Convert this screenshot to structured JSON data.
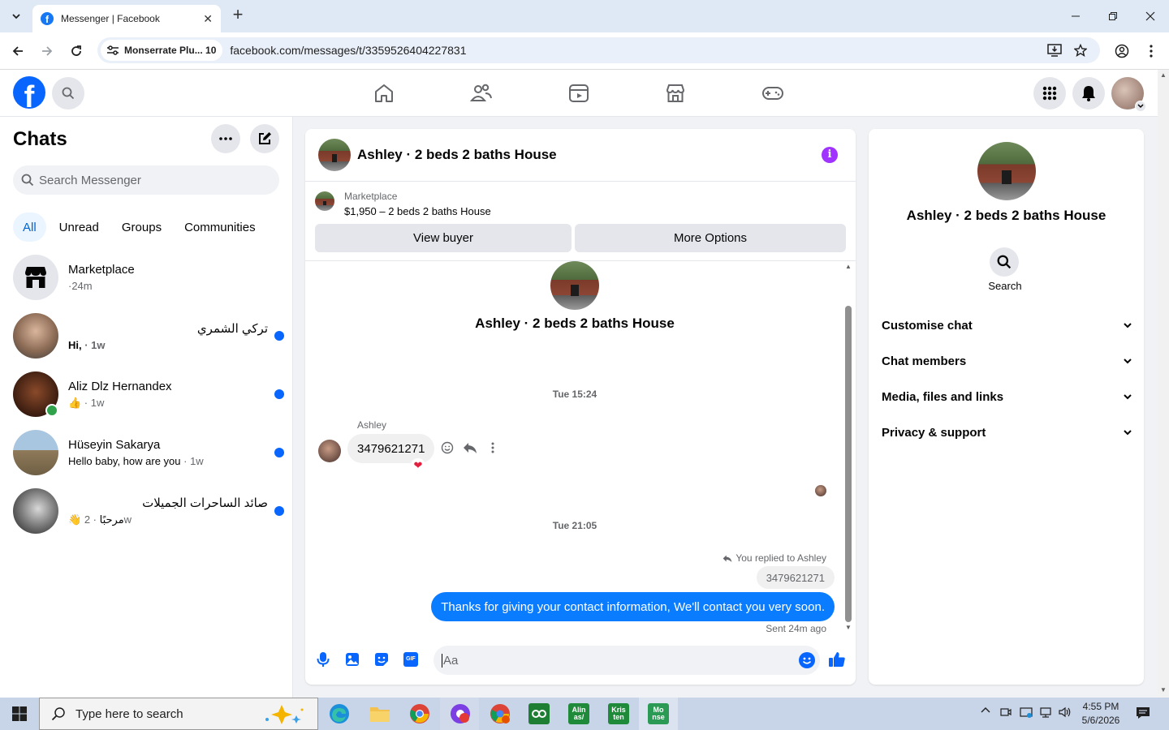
{
  "browser": {
    "tab_title": "Messenger | Facebook",
    "site_chip": "Monserrate Plu... 10",
    "url": "facebook.com/messages/t/3359526404227831"
  },
  "sidebar": {
    "title": "Chats",
    "search_placeholder": "Search Messenger",
    "filters": [
      "All",
      "Unread",
      "Groups",
      "Communities"
    ],
    "conversations": [
      {
        "name": "Marketplace",
        "preview": "",
        "meta": "·24m",
        "unread": false
      },
      {
        "name": "تركي الشمري",
        "preview": "Hi,",
        "meta": " · 1w",
        "unread": true
      },
      {
        "name": "Aliz Dlz Hernandex",
        "preview": "👍",
        "meta": " · 1w",
        "unread": true
      },
      {
        "name": "Hüseyin Sakarya",
        "preview": "Hello baby, how are you",
        "meta": " · 1w",
        "unread": true
      },
      {
        "name": "صائد الساحرات الجميلات",
        "preview": "👋 مرحبًا",
        "meta": " · 2w",
        "unread": true
      }
    ]
  },
  "chat": {
    "title": "Ashley · 2 beds 2 baths House",
    "marketplace_label": "Marketplace",
    "listing": "$1,950 – 2 beds 2 baths House",
    "view_buyer": "View buyer",
    "more_options": "More Options",
    "center_name": "Ashley · 2 beds 2 baths House",
    "time1": "Tue 15:24",
    "sender": "Ashley",
    "received_msg": "3479621271",
    "reaction": "❤",
    "time2": "Tue 21:05",
    "replied_to": "You replied to Ashley",
    "quoted": "3479621271",
    "sent_msg": "Thanks for giving your contact information, We'll contact you very soon.",
    "sent_status": "Sent 24m ago",
    "composer_placeholder": "Aa",
    "gif_label": "GIF"
  },
  "info_panel": {
    "name": "Ashley · 2 beds 2 baths House",
    "search_label": "Search",
    "sections": [
      "Customise chat",
      "Chat members",
      "Media, files and links",
      "Privacy & support"
    ]
  },
  "taskbar": {
    "search_placeholder": "Type here to search",
    "app_alinas": "Alin as/",
    "app_kristen": "Kris ten",
    "app_monse": "Mo nse",
    "time": "4:55 PM",
    "date": "5/6/2026"
  },
  "colors": {
    "fb_blue": "#0866ff",
    "sent_bubble": "#0a7cff",
    "info_purple": "#a033ff"
  }
}
